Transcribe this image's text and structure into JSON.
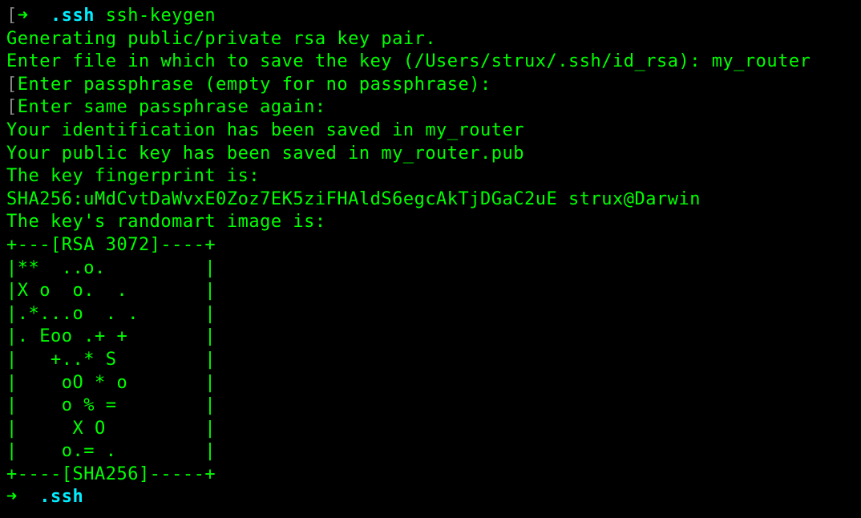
{
  "prompt1": {
    "bracket": "[",
    "arrow": "➜  ",
    "dir": ".ssh",
    "cmd": " ssh-keygen"
  },
  "output": {
    "l1": "Generating public/private rsa key pair.",
    "l2": "Enter file in which to save the key (/Users/strux/.ssh/id_rsa): my_router",
    "l3a": "[",
    "l3b": "Enter passphrase (empty for no passphrase):",
    "l4a": "[",
    "l4b": "Enter same passphrase again:",
    "l5": "Your identification has been saved in my_router",
    "l6": "Your public key has been saved in my_router.pub",
    "l7": "The key fingerprint is:",
    "l8": "SHA256:uMdCvtDaWvxE0Zoz7EK5ziFHAldS6egcAkTjDGaC2uE strux@Darwin",
    "l9": "The key's randomart image is:",
    "art1": "+---[RSA 3072]----+",
    "art2": "|**  ..o.         |",
    "art3": "|X o  o.  .       |",
    "art4": "|.*...o  . .      |",
    "art5": "|. Eoo .+ +       |",
    "art6": "|   +..* S        |",
    "art7": "|    oO * o       |",
    "art8": "|    o % =        |",
    "art9": "|     X O         |",
    "art10": "|    o.= .        |",
    "art11": "+----[SHA256]-----+"
  },
  "prompt2": {
    "arrow": "➜  ",
    "dir": ".ssh"
  }
}
